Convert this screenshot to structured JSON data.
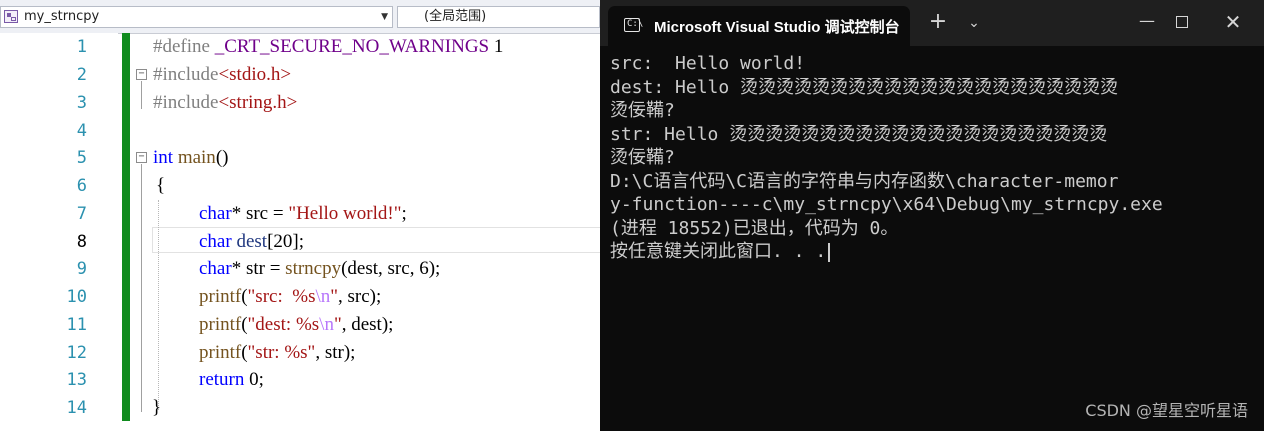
{
  "editor": {
    "scope_dropdown": "my_strncpy",
    "global_dropdown": "(全局范围)",
    "line_numbers": [
      "1",
      "2",
      "3",
      "4",
      "5",
      "6",
      "7",
      "8",
      "9",
      "10",
      "11",
      "12",
      "13",
      "14"
    ],
    "code": {
      "l1_directive": "#define",
      "l1_macro": "_CRT_SECURE_NO_WARNINGS",
      "l1_value": "1",
      "l2_directive": "#include",
      "l2_header": "<stdio.h>",
      "l3_directive": "#include",
      "l3_header": "<string.h>",
      "l5_type": "int",
      "l5_fn": "main",
      "l5_parens": "()",
      "l6_open": "{",
      "l7_type": "char",
      "l7_rest": "* src =",
      "l7_str": "\"Hello world!\"",
      "l7_end": ";",
      "l8_type": "char",
      "l8_var": "dest",
      "l8_open": "[",
      "l8_num": "20",
      "l8_end": "];",
      "l9_type": "char",
      "l9_a": "* str =",
      "l9_fn": "strncpy",
      "l9_b": "(dest, src,",
      "l9_num": "6",
      "l9_end": ");",
      "l10_fn": "printf",
      "l10_open": "(",
      "l10_str1": "\"src:  %s",
      "l10_esc": "\\n",
      "l10_str2": "\"",
      "l10_end": ", src);",
      "l11_fn": "printf",
      "l11_open": "(",
      "l11_str1": "\"dest: %s",
      "l11_esc": "\\n",
      "l11_str2": "\"",
      "l11_end": ", dest);",
      "l12_fn": "printf",
      "l12_open": "(",
      "l12_str": "\"str: %s\"",
      "l12_end": ", str);",
      "l13_kw": "return",
      "l13_num": "0",
      "l13_end": ";",
      "l14_close": "}"
    }
  },
  "console": {
    "tab_title": "Microsoft Visual Studio 调试控制台",
    "icon_label": "C:\\",
    "new_tab": "+",
    "dropdown": "⌄",
    "minimize": "—",
    "close": "✕",
    "lines": [
      "src:  Hello world!",
      "dest: Hello 烫烫烫烫烫烫烫烫烫烫烫烫烫烫烫烫烫烫烫烫烫",
      "烫佞鞴?",
      "str: Hello 烫烫烫烫烫烫烫烫烫烫烫烫烫烫烫烫烫烫烫烫烫",
      "烫佞鞴?",
      "D:\\C语言代码\\C语言的字符串与内存函数\\character-memor",
      "y-function----c\\my_strncpy\\x64\\Debug\\my_strncpy.exe",
      "(进程 18552)已退出，代码为 0。",
      "按任意键关闭此窗口. . ."
    ],
    "watermark": "CSDN @望星空听星语"
  },
  "colors": {
    "change_bar": "#108b1e",
    "line_number": "#2b91af",
    "keyword": "#0000ff",
    "string": "#a31515",
    "macro": "#6f008a",
    "console_bg": "#0c0c0c",
    "console_text": "#cccccc"
  }
}
